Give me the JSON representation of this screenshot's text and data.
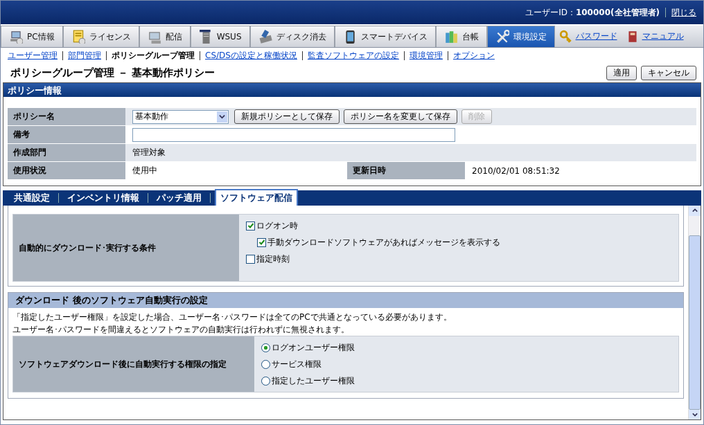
{
  "header": {
    "user": "ユーザーID：**100000(全社管理者)**",
    "close_link": "閉じる"
  },
  "nav_tabs": [
    {
      "label": "PC情報",
      "selected": false
    },
    {
      "label": "ライセンス",
      "selected": false
    },
    {
      "label": "配信",
      "selected": false
    },
    {
      "label": "WSUS",
      "selected": false
    },
    {
      "label": "ディスク消去",
      "selected": false
    },
    {
      "label": "スマートデバイス",
      "selected": false
    },
    {
      "label": "台帳",
      "selected": false
    },
    {
      "label": "環境設定",
      "selected": true
    }
  ],
  "nav_links": [
    {
      "label": "パスワード"
    },
    {
      "label": "マニュアル"
    }
  ],
  "sub_nav": [
    {
      "label": "ユーザー管理",
      "selected": false
    },
    {
      "label": "部門管理",
      "selected": false
    },
    {
      "label": "ポリシーグループ管理",
      "selected": true
    },
    {
      "label": "CS/DSの設定と稼働状況",
      "selected": false
    },
    {
      "label": "監査ソフトウェアの設定",
      "selected": false
    },
    {
      "label": "環境管理",
      "selected": false
    },
    {
      "label": "オプション",
      "selected": false
    }
  ],
  "page_title": "ポリシーグループ管理 － 基本動作ポリシー",
  "page_buttons": [
    "適用",
    "キャンセル"
  ],
  "policy_info": {
    "title": "ポリシー情報",
    "name_label": "ポリシー名",
    "name_value": "基本動作",
    "name_buttons": [
      {
        "label": "新規ポリシーとして保存",
        "disabled": false
      },
      {
        "label": "ポリシー名を変更して保存",
        "disabled": false
      },
      {
        "label": "削除",
        "disabled": true
      }
    ],
    "note_label": "備考",
    "dept_label": "作成部門",
    "dept_value": "管理対象",
    "status_label": "使用状況",
    "status_value": "使用中",
    "updated_label": "更新日時",
    "updated_value": "2010/02/01 08:51:32"
  },
  "tabs": [
    {
      "label": "共通設定",
      "selected": false
    },
    {
      "label": "インベントリ情報",
      "selected": false
    },
    {
      "label": "パッチ適用",
      "selected": false
    },
    {
      "label": "ソフトウェア配信",
      "selected": true
    }
  ],
  "condition": {
    "label": "自動的にダウンロード･実行する条件",
    "options": [
      {
        "label": "ログオン時",
        "checked": true,
        "children": [
          {
            "label": "手動ダウンロードソフトウェアがあればメッセージを表示する",
            "checked": true
          }
        ]
      },
      {
        "label": "指定時刻",
        "checked": false
      }
    ]
  },
  "auto_run": {
    "title": "ダウンロード 後のソフトウェア自動実行の設定",
    "notes": [
      "「指定したユーザー権限」を設定した場合、ユーザー名･パスワードは全てのPCで共通となっている必要があります。",
      "ユーザー名･パスワードを間違えるとソフトウェアの自動実行は行われずに無視されます。"
    ],
    "label": "ソフトウェアダウンロード後に自動実行する権限の指定",
    "options": [
      {
        "label": "ログオンユーザー権限",
        "selected": true
      },
      {
        "label": "サービス権限",
        "selected": false
      },
      {
        "label": "指定したユーザー権限",
        "selected": false
      }
    ]
  }
}
